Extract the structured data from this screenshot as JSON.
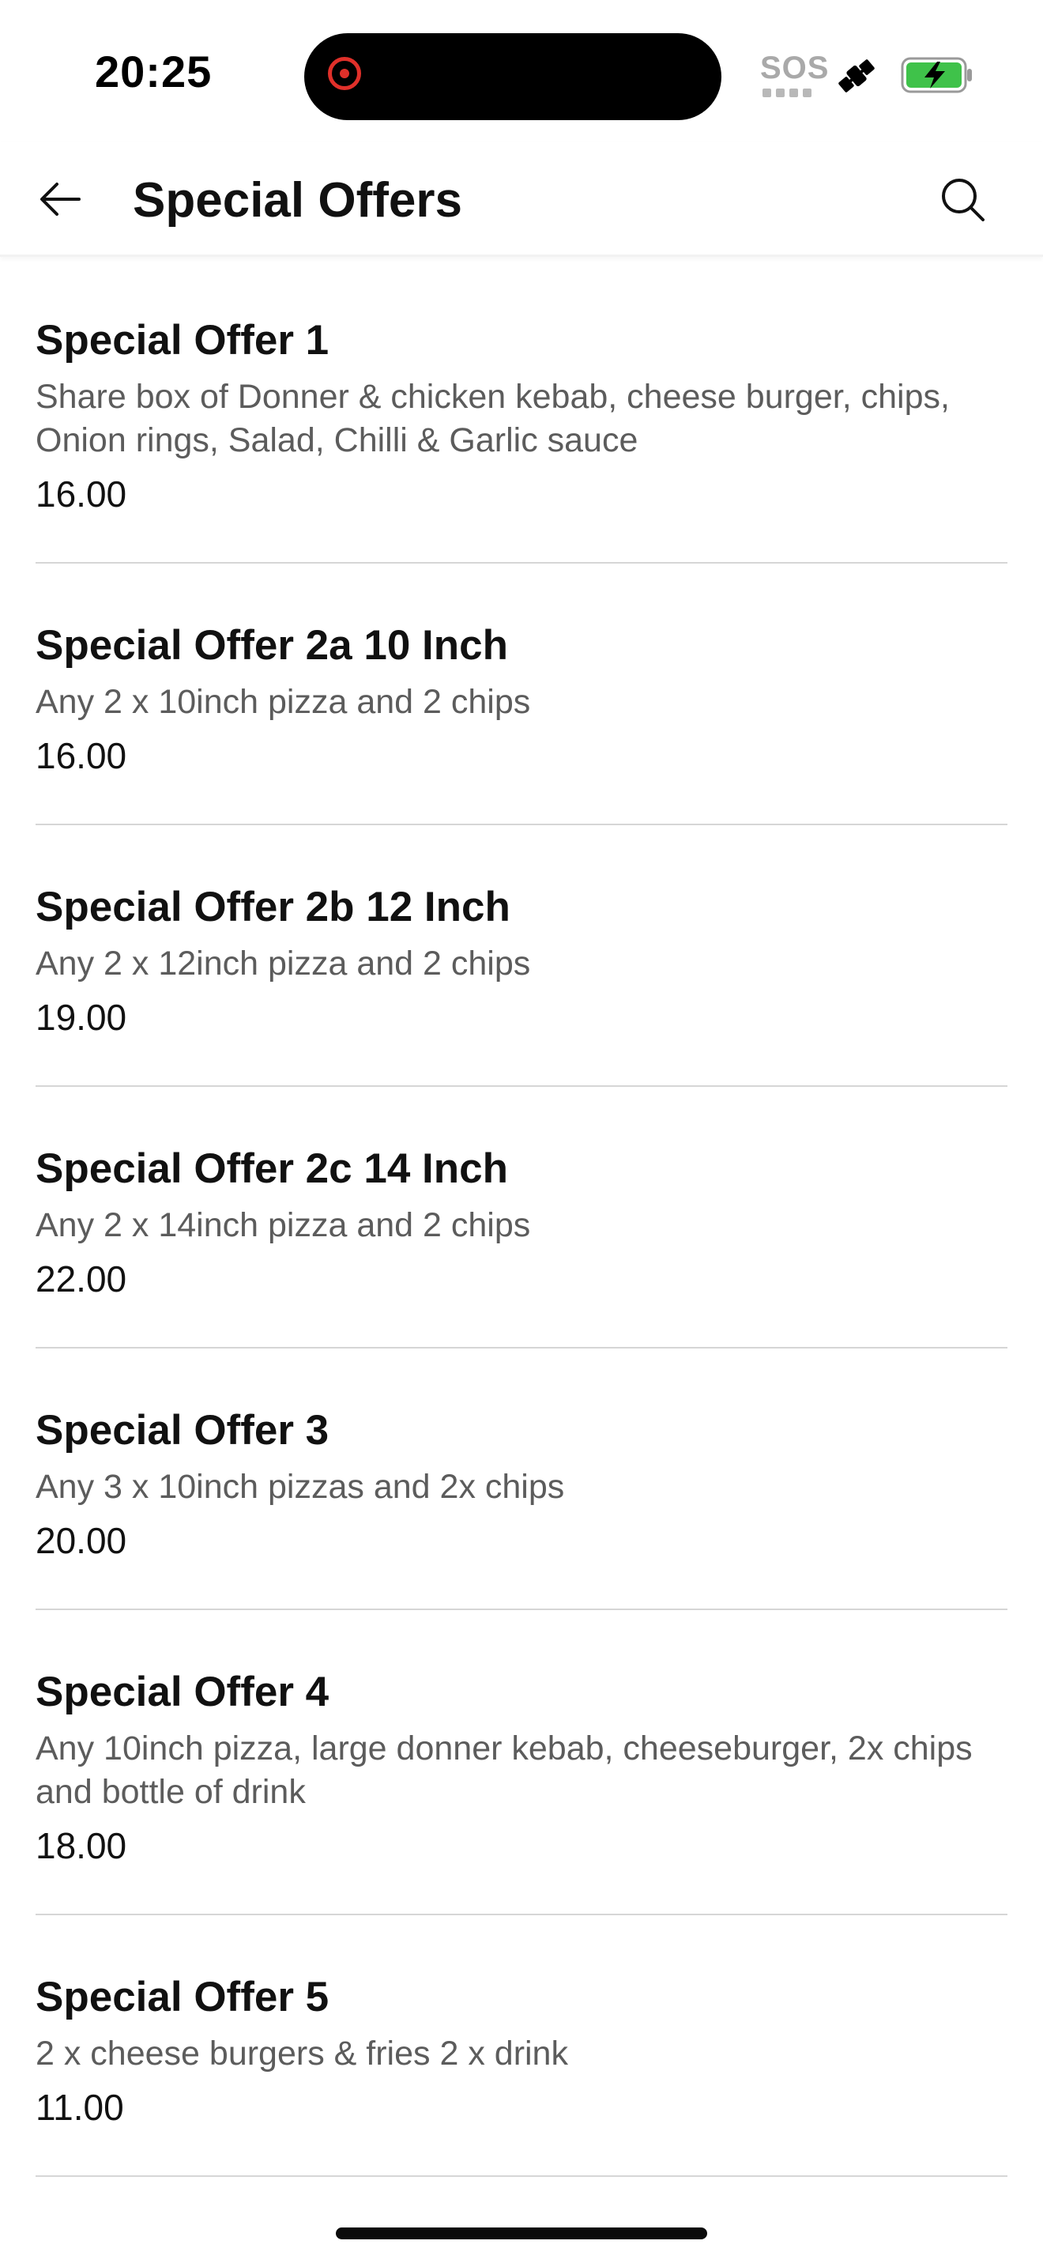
{
  "status_bar": {
    "time": "20:25",
    "sos_label": "SOS",
    "icons": [
      "screen-recording-icon",
      "satellite-icon",
      "battery-charging-icon"
    ],
    "battery_color": "#3fc24a",
    "recording_color": "#e0302a"
  },
  "header": {
    "title": "Special Offers",
    "back_icon": "arrow-left-icon",
    "search_icon": "search-icon"
  },
  "offers": [
    {
      "name": "Special Offer 1",
      "description": "Share box of Donner & chicken kebab, cheese burger, chips, Onion rings, Salad, Chilli & Garlic sauce",
      "price": "16.00"
    },
    {
      "name": "Special Offer 2a 10 Inch",
      "description": "Any 2 x 10inch pizza and 2 chips",
      "price": "16.00"
    },
    {
      "name": "Special Offer 2b 12 Inch",
      "description": "Any 2 x 12inch pizza and 2 chips",
      "price": "19.00"
    },
    {
      "name": "Special Offer 2c 14 Inch",
      "description": "Any 2 x 14inch pizza and 2 chips",
      "price": "22.00"
    },
    {
      "name": "Special Offer 3",
      "description": "Any 3 x 10inch pizzas and 2x chips",
      "price": "20.00"
    },
    {
      "name": "Special Offer 4",
      "description": "Any 10inch pizza, large donner kebab, cheeseburger, 2x chips and bottle of drink",
      "price": "18.00"
    },
    {
      "name": "Special Offer 5",
      "description": "2 x cheese burgers & fries 2 x drink",
      "price": "11.00"
    }
  ]
}
